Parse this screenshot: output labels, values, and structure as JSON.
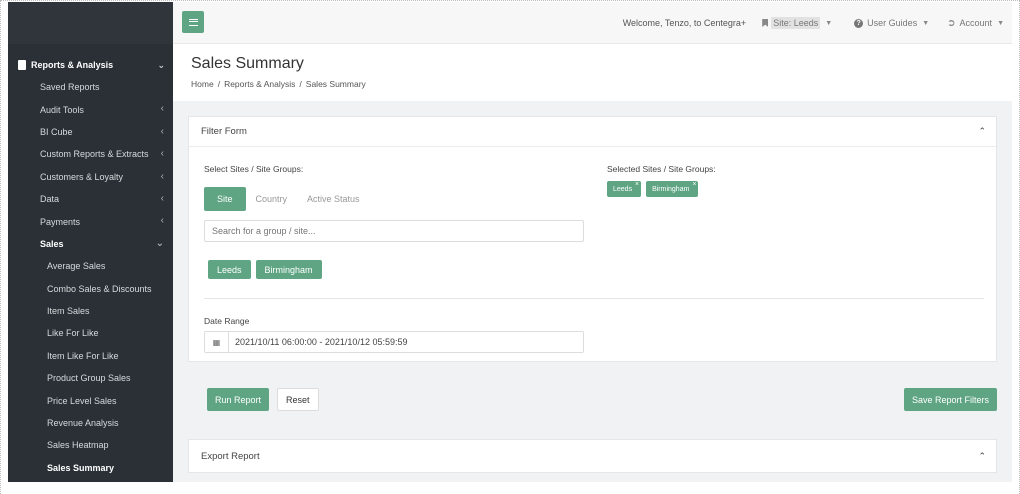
{
  "sidebar": {
    "section": {
      "label": "Reports & Analysis"
    },
    "items": [
      {
        "label": "Saved Reports"
      },
      {
        "label": "Audit Tools"
      },
      {
        "label": "BI Cube"
      },
      {
        "label": "Custom Reports & Extracts"
      },
      {
        "label": "Customers & Loyalty"
      },
      {
        "label": "Data"
      },
      {
        "label": "Payments"
      },
      {
        "label": "Sales"
      }
    ],
    "sales_sub": [
      {
        "label": "Average Sales"
      },
      {
        "label": "Combo Sales & Discounts"
      },
      {
        "label": "Item Sales"
      },
      {
        "label": "Like For Like"
      },
      {
        "label": "Item Like For Like"
      },
      {
        "label": "Product Group Sales"
      },
      {
        "label": "Price Level Sales"
      },
      {
        "label": "Revenue Analysis"
      },
      {
        "label": "Sales Heatmap"
      },
      {
        "label": "Sales Summary"
      }
    ]
  },
  "topbar": {
    "welcome": "Welcome, Tenzo, to Centegra+",
    "site": "Site: Leeds",
    "guides": "User Guides",
    "account": "Account"
  },
  "page": {
    "title": "Sales Summary",
    "breadcrumb": [
      "Home",
      "Reports & Analysis",
      "Sales Summary"
    ]
  },
  "filter": {
    "header": "Filter Form",
    "select_label": "Select Sites / Site Groups:",
    "tabs": [
      "Site",
      "Country",
      "Active Status"
    ],
    "search_placeholder": "Search for a group / site...",
    "options": [
      "Leeds",
      "Birmingham"
    ],
    "selected_label": "Selected Sites / Site Groups:",
    "selected": [
      "Leeds",
      "Birmingham"
    ],
    "date_label": "Date Range",
    "date_value": "2021/10/11 06:00:00 - 2021/10/12 05:59:59",
    "run": "Run Report",
    "reset": "Reset",
    "save": "Save Report Filters"
  },
  "export": {
    "header": "Export Report"
  },
  "colors": {
    "accent": "#5fa583",
    "sidebar": "#2a3036"
  }
}
